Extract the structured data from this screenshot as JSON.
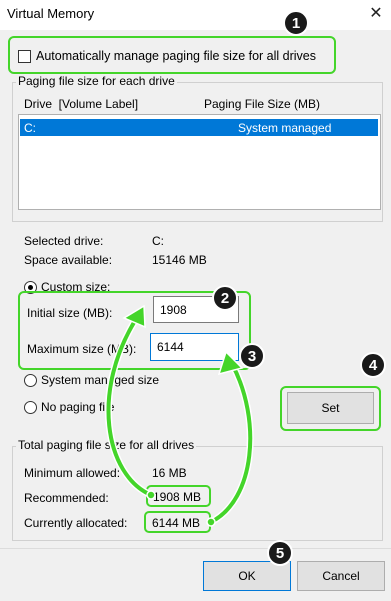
{
  "window": {
    "title": "Virtual Memory",
    "close_glyph": "✕"
  },
  "auto_manage": {
    "label": "Automatically manage paging file size for all drives",
    "checked": false
  },
  "paging_group": {
    "legend": "Paging file size for each drive",
    "col_drive": "Drive  [Volume Label]",
    "col_size": "Paging File Size (MB)",
    "rows": [
      {
        "drive": "C:",
        "size": "System managed"
      }
    ]
  },
  "selected_drive": {
    "label": "Selected drive:",
    "value": "C:"
  },
  "space_available": {
    "label": "Space available:",
    "value": "15146 MB"
  },
  "options": {
    "custom_label": "Custom size:",
    "initial_label": "Initial size (MB):",
    "initial_value": "1908",
    "maximum_label": "Maximum size (MB):",
    "maximum_value": "6144",
    "system_label": "System managed size",
    "no_paging_label": "No paging file",
    "set_label": "Set"
  },
  "totals": {
    "legend": "Total paging file size for all drives",
    "min_label": "Minimum allowed:",
    "min_value": "16 MB",
    "rec_label": "Recommended:",
    "rec_value": "1908 MB",
    "cur_label": "Currently allocated:",
    "cur_value": "6144 MB"
  },
  "footer": {
    "ok": "OK",
    "cancel": "Cancel"
  },
  "badges": [
    "1",
    "2",
    "3",
    "4",
    "5"
  ],
  "colors": {
    "highlight": "#44d52a",
    "selection": "#0078d7",
    "badge": "#1a1a1a"
  }
}
